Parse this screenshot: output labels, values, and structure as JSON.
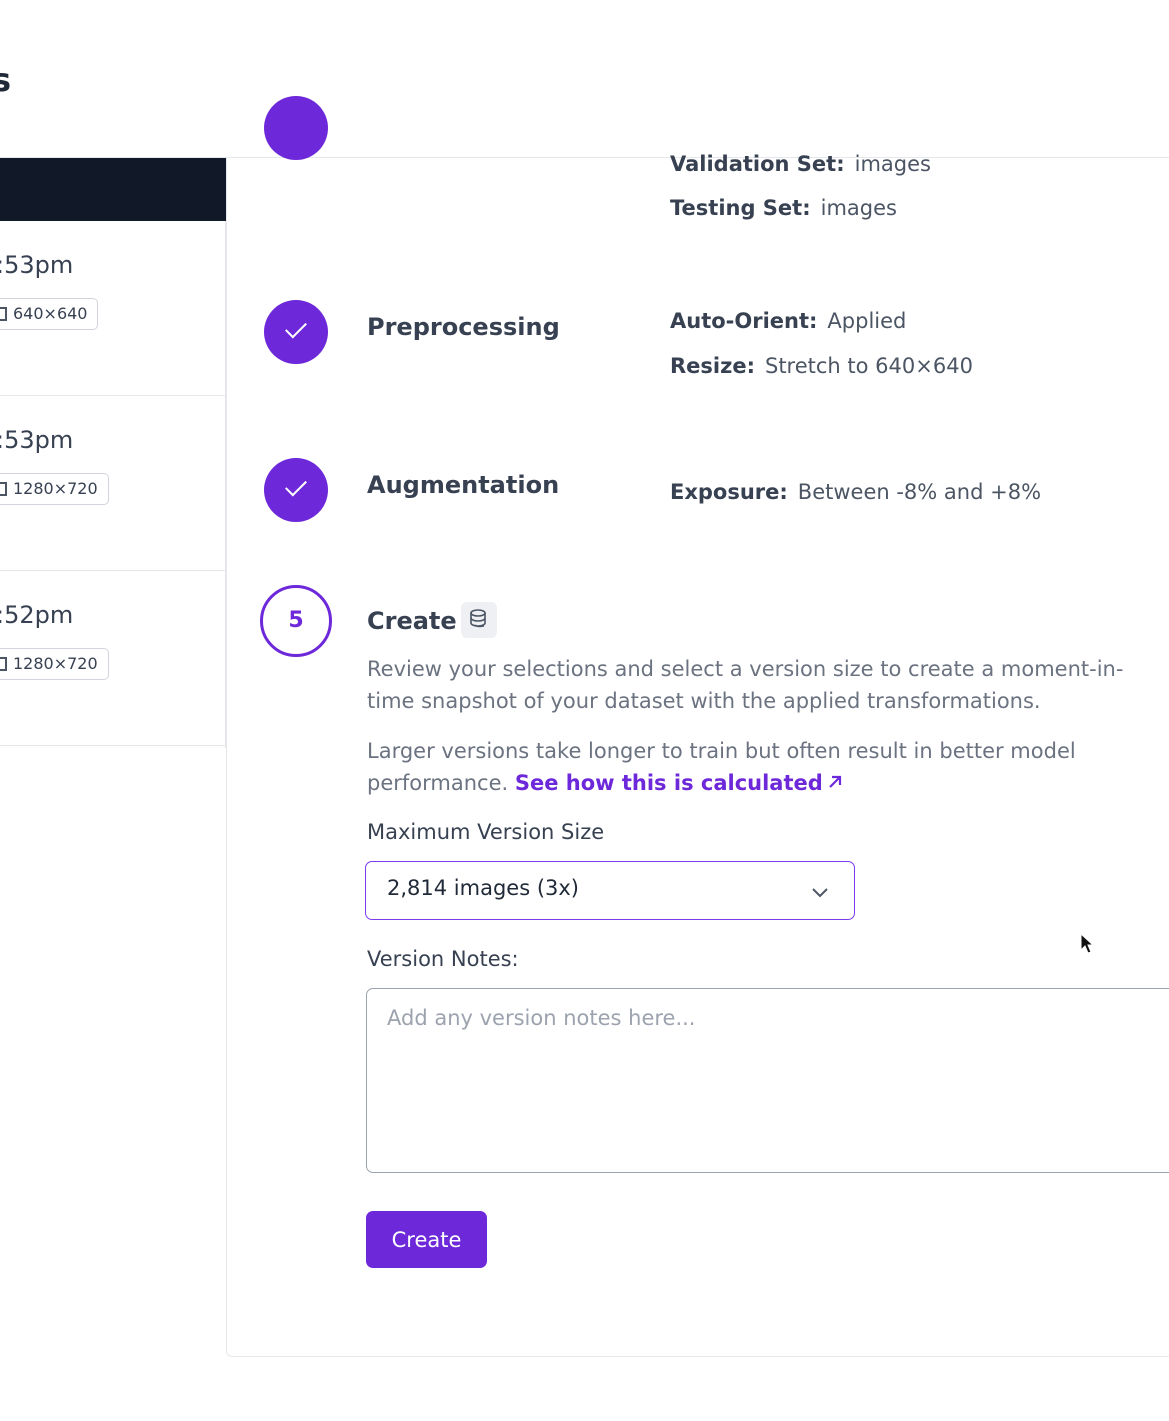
{
  "header": {
    "title": "s"
  },
  "versions": [
    {
      "time": ":53pm",
      "dimensions": "640×640"
    },
    {
      "time": ":53pm",
      "dimensions": "1280×720"
    },
    {
      "time": ":52pm",
      "dimensions": "1280×720"
    }
  ],
  "split": {
    "validation_label": "Validation Set:",
    "validation_value": "images",
    "testing_label": "Testing Set:",
    "testing_value": "images"
  },
  "preprocessing": {
    "title": "Preprocessing",
    "auto_orient_label": "Auto-Orient:",
    "auto_orient_value": "Applied",
    "resize_label": "Resize:",
    "resize_value": "Stretch to 640×640"
  },
  "augmentation": {
    "title": "Augmentation",
    "exposure_label": "Exposure:",
    "exposure_value": "Between -8% and +8%"
  },
  "create_step": {
    "number": "5",
    "title": "Create",
    "description": "Review your selections and select a version size to create a moment-in-time snapshot of your dataset with the applied transformations.",
    "size_note": "Larger versions take longer to train but often result in better model performance.",
    "link_text": "See how this is calculated",
    "link_icon": "arrow-up-right-icon",
    "max_size_label": "Maximum Version Size",
    "max_size_value": "2,814 images (3x)",
    "notes_label": "Version Notes:",
    "notes_placeholder": "Add any version notes here...",
    "notes_value": "",
    "create_button": "Create"
  },
  "colors": {
    "accent": "#6d28d9",
    "dark_header": "#111827"
  }
}
